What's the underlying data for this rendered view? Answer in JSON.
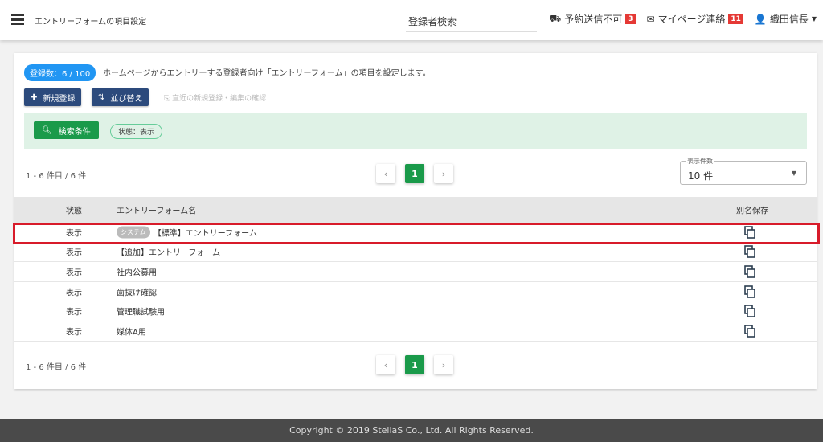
{
  "header": {
    "page_title": "エントリーフォームの項目設定",
    "search_label": "登録者検索",
    "reservation_label": "予約送信不可",
    "reservation_count": "3",
    "mypage_label": "マイページ連絡",
    "mypage_count": "11",
    "user_name": "織田信長"
  },
  "toolbar": {
    "count_badge": "登録数：6 / 100",
    "description": "ホームページからエントリーする登録者向け「エントリーフォーム」の項目を設定します。",
    "new_label": "新規登録",
    "sort_label": "並び替え",
    "recent_label": "直近の新規登録・編集の確認"
  },
  "filter": {
    "search_label": "検索条件",
    "chip": "状態：表示"
  },
  "pagination": {
    "range": "1 - 6 件目 / 6 件",
    "prev": "‹",
    "page": "1",
    "next": "›",
    "per_page_label": "表示件数",
    "per_page_value": "10 件"
  },
  "table": {
    "headers": [
      "状態",
      "エントリーフォーム名",
      "別名保存"
    ],
    "system_tag": "システム",
    "rows": [
      {
        "status": "表示",
        "name": "【標準】エントリーフォーム"
      },
      {
        "status": "表示",
        "name": "【追加】エントリーフォーム"
      },
      {
        "status": "表示",
        "name": "社内公募用"
      },
      {
        "status": "表示",
        "name": "歯抜け確認"
      },
      {
        "status": "表示",
        "name": "管理職試験用"
      },
      {
        "status": "表示",
        "name": "媒体A用"
      }
    ]
  },
  "footer": {
    "copyright": "Copyright © 2019 StellaS Co., Ltd. All Rights Reserved."
  }
}
